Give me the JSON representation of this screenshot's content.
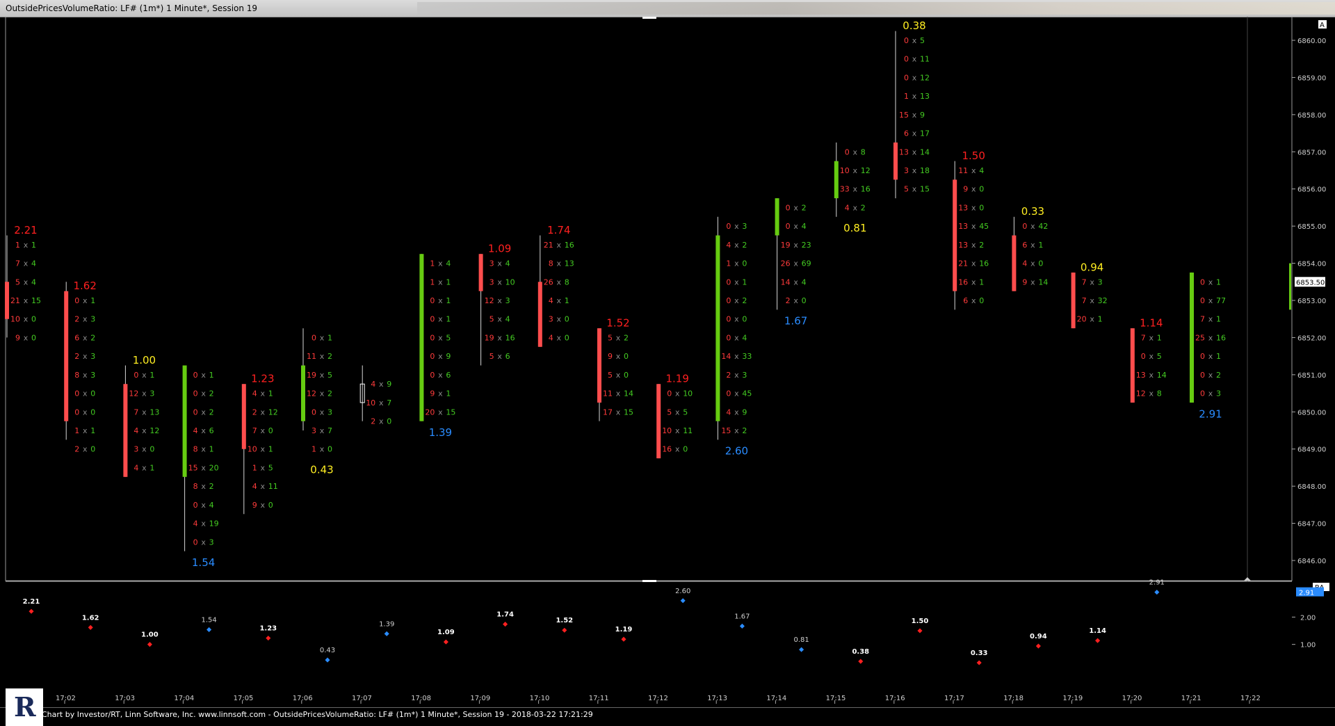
{
  "window": {
    "title": "OutsidePricesVolumeRatio: LF# (1m*) 1 Minute*, Session 19"
  },
  "footer": {
    "credit": "Chart by Investor/RT, Linn Software, Inc. www.linnsoft.com - OutsidePricesVolumeRatio: LF# (1m*) 1 Minute*, Session 19 - 2018-03-22 17:21:29"
  },
  "colors": {
    "up": "#66cc11",
    "down": "#ff4d4d",
    "ratio_high": "#ff2020",
    "ratio_low": "#2a8cff",
    "ratio_mid": "#ffee22",
    "bid": "#ff3b3b",
    "ask": "#44cc22"
  },
  "chart_data": [
    {
      "type": "candlestick-footprint",
      "price_axis": {
        "ticks": [
          "6860.00",
          "6859.00",
          "6858.00",
          "6857.00",
          "6856.00",
          "6855.00",
          "6854.00",
          "6853.00",
          "6852.00",
          "6851.00",
          "6850.00",
          "6849.00",
          "6848.00",
          "6847.00",
          "6846.00"
        ],
        "current": "6853.50",
        "ylim": [
          6845.5,
          6860.75
        ]
      },
      "time_axis": [
        "17:02",
        "17:03",
        "17:04",
        "17:05",
        "17:06",
        "17:07",
        "17:08",
        "17:09",
        "17:10",
        "17:11",
        "17:12",
        "17:13",
        "17:14",
        "17:15",
        "17:16",
        "17:17",
        "17:18",
        "17:19",
        "17:20",
        "17:21",
        "17:22"
      ],
      "corner_label": "A",
      "bars": [
        {
          "o": 6853.5,
          "c": 6852.5,
          "h": 6854.75,
          "l": 6852.0,
          "ratio": "2.21",
          "ratio_pos": "top",
          "ratio_color": "red",
          "cells": [
            [
              "1",
              "1"
            ],
            [
              "7",
              "4"
            ],
            [
              "5",
              "4"
            ],
            [
              "21",
              "15"
            ],
            [
              "10",
              "0"
            ],
            [
              "9",
              "0"
            ]
          ],
          "cell_top": 6854.5
        },
        {
          "o": 6853.25,
          "c": 6849.75,
          "h": 6853.5,
          "l": 6849.25,
          "ratio": "1.62",
          "ratio_pos": "top",
          "ratio_color": "red",
          "cells": [
            [
              "0",
              "1"
            ],
            [
              "2",
              "3"
            ],
            [
              "6",
              "2"
            ],
            [
              "2",
              "3"
            ],
            [
              "8",
              "3"
            ],
            [
              "0",
              "0"
            ],
            [
              "0",
              "0"
            ],
            [
              "1",
              "1"
            ],
            [
              "2",
              "0"
            ]
          ],
          "cell_top": 6853.0
        },
        {
          "o": 6850.75,
          "c": 6848.25,
          "h": 6851.25,
          "l": 6848.25,
          "ratio": "1.00",
          "ratio_pos": "top",
          "ratio_color": "yellow",
          "cells": [
            [
              "0",
              "1"
            ],
            [
              "12",
              "3"
            ],
            [
              "7",
              "13"
            ],
            [
              "4",
              "12"
            ],
            [
              "3",
              "0"
            ],
            [
              "4",
              "1"
            ]
          ],
          "cell_top": 6851.0
        },
        {
          "o": 6848.25,
          "c": 6851.25,
          "h": 6851.25,
          "l": 6846.25,
          "ratio": "1.54",
          "ratio_pos": "bottom",
          "ratio_color": "blue",
          "cells": [
            [
              "0",
              "1"
            ],
            [
              "0",
              "2"
            ],
            [
              "0",
              "2"
            ],
            [
              "4",
              "6"
            ],
            [
              "8",
              "1"
            ],
            [
              "15",
              "20"
            ],
            [
              "8",
              "2"
            ],
            [
              "0",
              "4"
            ],
            [
              "4",
              "19"
            ],
            [
              "0",
              "3"
            ]
          ],
          "cell_top": 6851.0
        },
        {
          "o": 6850.75,
          "c": 6849.0,
          "h": 6850.75,
          "l": 6847.25,
          "ratio": "1.23",
          "ratio_pos": "top",
          "ratio_color": "red",
          "cells": [
            [
              "4",
              "1"
            ],
            [
              "2",
              "12"
            ],
            [
              "7",
              "0"
            ],
            [
              "10",
              "1"
            ],
            [
              "1",
              "5"
            ],
            [
              "4",
              "11"
            ],
            [
              "9",
              "0"
            ]
          ],
          "cell_top": 6850.5
        },
        {
          "o": 6849.75,
          "c": 6851.25,
          "h": 6852.25,
          "l": 6849.5,
          "ratio": "0.43",
          "ratio_pos": "bottom",
          "ratio_color": "yellow",
          "cells": [
            [
              "0",
              "1"
            ],
            [
              "11",
              "2"
            ],
            [
              "19",
              "5"
            ],
            [
              "12",
              "2"
            ],
            [
              "0",
              "3"
            ],
            [
              "3",
              "7"
            ],
            [
              "1",
              "0"
            ]
          ],
          "cell_top": 6852.0
        },
        {
          "o": 6850.75,
          "c": 6850.25,
          "h": 6851.25,
          "l": 6849.75,
          "doji": true,
          "ratio": "",
          "ratio_pos": "none",
          "ratio_color": "",
          "cells": [
            [
              "4",
              "9"
            ],
            [
              "10",
              "7"
            ],
            [
              "2",
              "0"
            ]
          ],
          "cell_top": 6850.75
        },
        {
          "o": 6849.75,
          "c": 6854.25,
          "h": 6854.25,
          "l": 6849.75,
          "ratio": "1.39",
          "ratio_pos": "bottom",
          "ratio_color": "blue",
          "cells": [
            [
              "1",
              "4"
            ],
            [
              "1",
              "1"
            ],
            [
              "0",
              "1"
            ],
            [
              "0",
              "1"
            ],
            [
              "0",
              "5"
            ],
            [
              "0",
              "9"
            ],
            [
              "0",
              "6"
            ],
            [
              "9",
              "1"
            ],
            [
              "20",
              "15"
            ]
          ],
          "cell_top": 6854.0
        },
        {
          "o": 6854.25,
          "c": 6853.25,
          "h": 6854.25,
          "l": 6851.25,
          "ratio": "1.09",
          "ratio_pos": "top",
          "ratio_color": "red",
          "cells": [
            [
              "3",
              "4"
            ],
            [
              "3",
              "10"
            ],
            [
              "12",
              "3"
            ],
            [
              "5",
              "4"
            ],
            [
              "19",
              "16"
            ],
            [
              "5",
              "6"
            ]
          ],
          "cell_top": 6854.0
        },
        {
          "o": 6853.5,
          "c": 6851.75,
          "h": 6854.75,
          "l": 6851.75,
          "ratio": "1.74",
          "ratio_pos": "top",
          "ratio_color": "red",
          "cells": [
            [
              "21",
              "16"
            ],
            [
              "8",
              "13"
            ],
            [
              "26",
              "8"
            ],
            [
              "4",
              "1"
            ],
            [
              "3",
              "0"
            ],
            [
              "4",
              "0"
            ]
          ],
          "cell_top": 6854.5
        },
        {
          "o": 6852.25,
          "c": 6850.25,
          "h": 6852.25,
          "l": 6849.75,
          "ratio": "1.52",
          "ratio_pos": "top",
          "ratio_color": "red",
          "cells": [
            [
              "5",
              "2"
            ],
            [
              "9",
              "0"
            ],
            [
              "5",
              "0"
            ],
            [
              "11",
              "14"
            ],
            [
              "17",
              "15"
            ]
          ],
          "cell_top": 6852.0
        },
        {
          "o": 6850.75,
          "c": 6848.75,
          "h": 6850.75,
          "l": 6848.75,
          "ratio": "1.19",
          "ratio_pos": "top",
          "ratio_color": "red",
          "cells": [
            [
              "0",
              "10"
            ],
            [
              "5",
              "5"
            ],
            [
              "10",
              "11"
            ],
            [
              "16",
              "0"
            ]
          ],
          "cell_top": 6850.5
        },
        {
          "o": 6849.75,
          "c": 6854.75,
          "h": 6855.25,
          "l": 6849.25,
          "ratio": "2.60",
          "ratio_pos": "bottom",
          "ratio_color": "blue",
          "cells": [
            [
              "0",
              "3"
            ],
            [
              "4",
              "2"
            ],
            [
              "1",
              "0"
            ],
            [
              "0",
              "1"
            ],
            [
              "0",
              "2"
            ],
            [
              "0",
              "0"
            ],
            [
              "0",
              "4"
            ],
            [
              "14",
              "33"
            ],
            [
              "2",
              "3"
            ],
            [
              "0",
              "45"
            ],
            [
              "4",
              "9"
            ],
            [
              "15",
              "2"
            ]
          ],
          "cell_top": 6855.0
        },
        {
          "o": 6854.75,
          "c": 6855.75,
          "h": 6855.75,
          "l": 6852.75,
          "ratio": "1.67",
          "ratio_pos": "bottom",
          "ratio_color": "blue",
          "cells": [
            [
              "0",
              "2"
            ],
            [
              "0",
              "4"
            ],
            [
              "19",
              "23"
            ],
            [
              "26",
              "69"
            ],
            [
              "14",
              "4"
            ],
            [
              "2",
              "0"
            ]
          ],
          "cell_top": 6855.5
        },
        {
          "o": 6855.75,
          "c": 6856.75,
          "h": 6857.25,
          "l": 6855.25,
          "ratio": "0.81",
          "ratio_pos": "bottom",
          "ratio_color": "yellow",
          "cells": [
            [
              "0",
              "8"
            ],
            [
              "10",
              "12"
            ],
            [
              "33",
              "16"
            ],
            [
              "4",
              "2"
            ]
          ],
          "cell_top": 6857.0
        },
        {
          "o": 6857.25,
          "c": 6856.25,
          "h": 6860.25,
          "l": 6855.75,
          "ratio": "0.38",
          "ratio_pos": "top",
          "ratio_color": "yellow",
          "cells": [
            [
              "0",
              "5"
            ],
            [
              "0",
              "11"
            ],
            [
              "0",
              "12"
            ],
            [
              "1",
              "13"
            ],
            [
              "15",
              "9"
            ],
            [
              "6",
              "17"
            ],
            [
              "13",
              "14"
            ],
            [
              "3",
              "18"
            ],
            [
              "5",
              "15"
            ]
          ],
          "cell_top": 6860.0
        },
        {
          "o": 6856.25,
          "c": 6853.25,
          "h": 6856.75,
          "l": 6852.75,
          "ratio": "1.50",
          "ratio_pos": "top",
          "ratio_color": "red",
          "cells": [
            [
              "11",
              "4"
            ],
            [
              "9",
              "0"
            ],
            [
              "13",
              "0"
            ],
            [
              "13",
              "45"
            ],
            [
              "13",
              "2"
            ],
            [
              "21",
              "16"
            ],
            [
              "16",
              "1"
            ],
            [
              "6",
              "0"
            ]
          ],
          "cell_top": 6856.5
        },
        {
          "o": 6854.75,
          "c": 6853.25,
          "h": 6855.25,
          "l": 6853.25,
          "ratio": "0.33",
          "ratio_pos": "top",
          "ratio_color": "yellow",
          "cells": [
            [
              "0",
              "42"
            ],
            [
              "6",
              "1"
            ],
            [
              "4",
              "0"
            ],
            [
              "9",
              "14"
            ]
          ],
          "cell_top": 6855.0
        },
        {
          "o": 6853.75,
          "c": 6852.25,
          "h": 6853.75,
          "l": 6852.25,
          "ratio": "0.94",
          "ratio_pos": "top",
          "ratio_color": "yellow",
          "cells": [
            [
              "7",
              "3"
            ],
            [
              "7",
              "32"
            ],
            [
              "20",
              "1"
            ]
          ],
          "cell_top": 6853.5
        },
        {
          "o": 6852.25,
          "c": 6850.25,
          "h": 6852.25,
          "l": 6850.25,
          "ratio": "1.14",
          "ratio_pos": "top",
          "ratio_color": "red",
          "cells": [
            [
              "7",
              "1"
            ],
            [
              "0",
              "5"
            ],
            [
              "13",
              "14"
            ],
            [
              "12",
              "8"
            ]
          ],
          "cell_top": 6852.0
        },
        {
          "o": 6850.25,
          "c": 6853.75,
          "h": 6853.75,
          "l": 6850.25,
          "ratio": "2.91",
          "ratio_pos": "bottom",
          "ratio_color": "blue",
          "cells": [
            [
              "0",
              "1"
            ],
            [
              "0",
              "77"
            ],
            [
              "7",
              "1"
            ],
            [
              "25",
              "16"
            ],
            [
              "0",
              "1"
            ],
            [
              "0",
              "2"
            ],
            [
              "0",
              "3"
            ]
          ],
          "cell_top": 6853.5
        }
      ]
    },
    {
      "type": "scatter",
      "indicator_label": "RA",
      "current": "2.91",
      "y_ticks": [
        "2.00",
        "1.00"
      ],
      "ylim": [
        0.0,
        2.95
      ],
      "points": [
        2.21,
        1.62,
        1.0,
        1.54,
        1.23,
        0.43,
        1.39,
        1.09,
        1.74,
        1.52,
        1.19,
        2.6,
        1.67,
        0.81,
        0.38,
        1.5,
        0.33,
        0.94,
        1.14,
        2.91
      ],
      "point_colors": [
        "red",
        "red",
        "red",
        "blue",
        "red",
        "blue",
        "blue",
        "red",
        "red",
        "red",
        "red",
        "blue",
        "blue",
        "blue",
        "red",
        "red",
        "red",
        "red",
        "red",
        "blue"
      ],
      "labels": [
        "2.21",
        "1.62",
        "1.00",
        "1.54",
        "1.23",
        "0.43",
        "1.39",
        "1.09",
        "1.74",
        "1.52",
        "1.19",
        "2.60",
        "1.67",
        "0.81",
        "0.38",
        "1.50",
        "0.33",
        "0.94",
        "1.14",
        "2.91"
      ]
    }
  ]
}
